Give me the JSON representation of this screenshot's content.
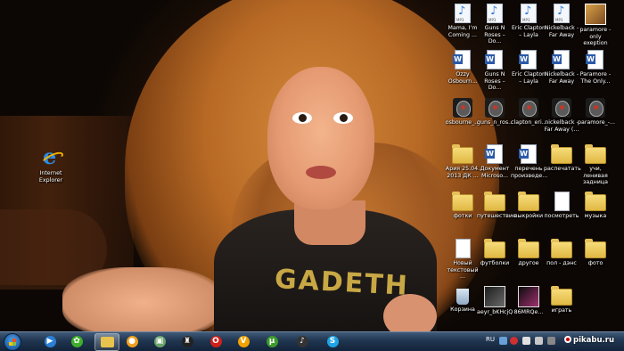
{
  "desktop": {
    "shirt_text": "GADETH",
    "left_icons": [
      {
        "label": "Internet\nExplorer",
        "icon": "internet-explorer-icon"
      }
    ],
    "grid_rows": [
      [
        {
          "label": "Mama, I'm\nComing ...",
          "icon": "mp3"
        },
        {
          "label": "Guns N\nRoses – Do...",
          "icon": "mp3"
        },
        {
          "label": "Eric Clapton\n– Layla",
          "icon": "mp3"
        },
        {
          "label": "Nickelback -\nFar Away",
          "icon": "mp3"
        },
        {
          "label": "paramore -\nonly exeption",
          "icon": "jpg"
        }
      ],
      [
        {
          "label": "Ozzy\nOsbourn...",
          "icon": "doc"
        },
        {
          "label": "Guns N\nRoses – Do...",
          "icon": "doc"
        },
        {
          "label": "Eric Clapton\n– Layla",
          "icon": "doc"
        },
        {
          "label": "Nickelback -\nFar Away",
          "icon": "doc"
        },
        {
          "label": "Paramore -\nThe Only...",
          "icon": "doc"
        }
      ],
      [
        {
          "label": "osbourne_...",
          "icon": "gp"
        },
        {
          "label": "guns_n_ros...",
          "icon": "gp"
        },
        {
          "label": "clapton_eri...",
          "icon": "gp"
        },
        {
          "label": "nickelback -\nFar Away (...",
          "icon": "gp"
        },
        {
          "label": "paramore_-...",
          "icon": "gp"
        }
      ],
      [
        {
          "label": "Ария 25.04.\n2013 ДК ...",
          "icon": "folder"
        },
        {
          "label": "Документ\nMicroso...",
          "icon": "doc"
        },
        {
          "label": "перечень\nпроизведе...",
          "icon": "doc"
        },
        {
          "label": "распечатать",
          "icon": "folder"
        },
        {
          "label": "учи, ленивая\nзадница",
          "icon": "folder"
        }
      ],
      [
        {
          "label": "фотки",
          "icon": "folder"
        },
        {
          "label": "путешествие",
          "icon": "folder"
        },
        {
          "label": "выкройки",
          "icon": "folder"
        },
        {
          "label": "посмотреть",
          "icon": "blank"
        },
        {
          "label": "музыка",
          "icon": "folder"
        }
      ],
      [
        {
          "label": "Новый\nтекстовый ...",
          "icon": "blank"
        },
        {
          "label": "футболки",
          "icon": "folder"
        },
        {
          "label": "другое",
          "icon": "folder"
        },
        {
          "label": "пол - дэнс",
          "icon": "folder"
        },
        {
          "label": "фото",
          "icon": "folder"
        }
      ],
      [
        {
          "label": "Корзина",
          "icon": "bin"
        },
        {
          "label": "аeyr_bKHcjQ",
          "icon": "photo"
        },
        {
          "label": "86MRQe...",
          "icon": "photo2"
        },
        {
          "label": "играть",
          "icon": "folder"
        },
        {
          "label": "",
          "icon": ""
        }
      ]
    ]
  },
  "taskbar": {
    "pinned": [
      {
        "name": "media-player-icon",
        "color": "#2a7fd4",
        "glyph": "▶",
        "active": false
      },
      {
        "name": "icq-icon",
        "color": "#3fae2a",
        "glyph": "✿",
        "active": false
      },
      {
        "name": "explorer-folder-icon",
        "color": "#e8c44e",
        "glyph": "",
        "active": true
      },
      {
        "name": "aimp-icon",
        "color": "#f0a020",
        "glyph": "●",
        "active": false
      },
      {
        "name": "window-icon",
        "color": "#6aa36a",
        "glyph": "▣",
        "active": false
      },
      {
        "name": "photo-app-icon",
        "color": "#222222",
        "glyph": "♜",
        "active": false
      },
      {
        "name": "opera-icon",
        "color": "#d0201a",
        "glyph": "O",
        "active": false
      },
      {
        "name": "v-app-icon",
        "color": "#f2a300",
        "glyph": "V",
        "active": false
      },
      {
        "name": "utorrent-icon",
        "color": "#3c9a2c",
        "glyph": "μ",
        "active": false
      },
      {
        "name": "guitar-pro-icon",
        "color": "#333333",
        "glyph": "♪",
        "active": false
      },
      {
        "name": "skype-icon",
        "color": "#1fa3e6",
        "glyph": "S",
        "active": false
      }
    ],
    "language": "RU",
    "clock": "",
    "watermark": "pikabu.ru"
  }
}
